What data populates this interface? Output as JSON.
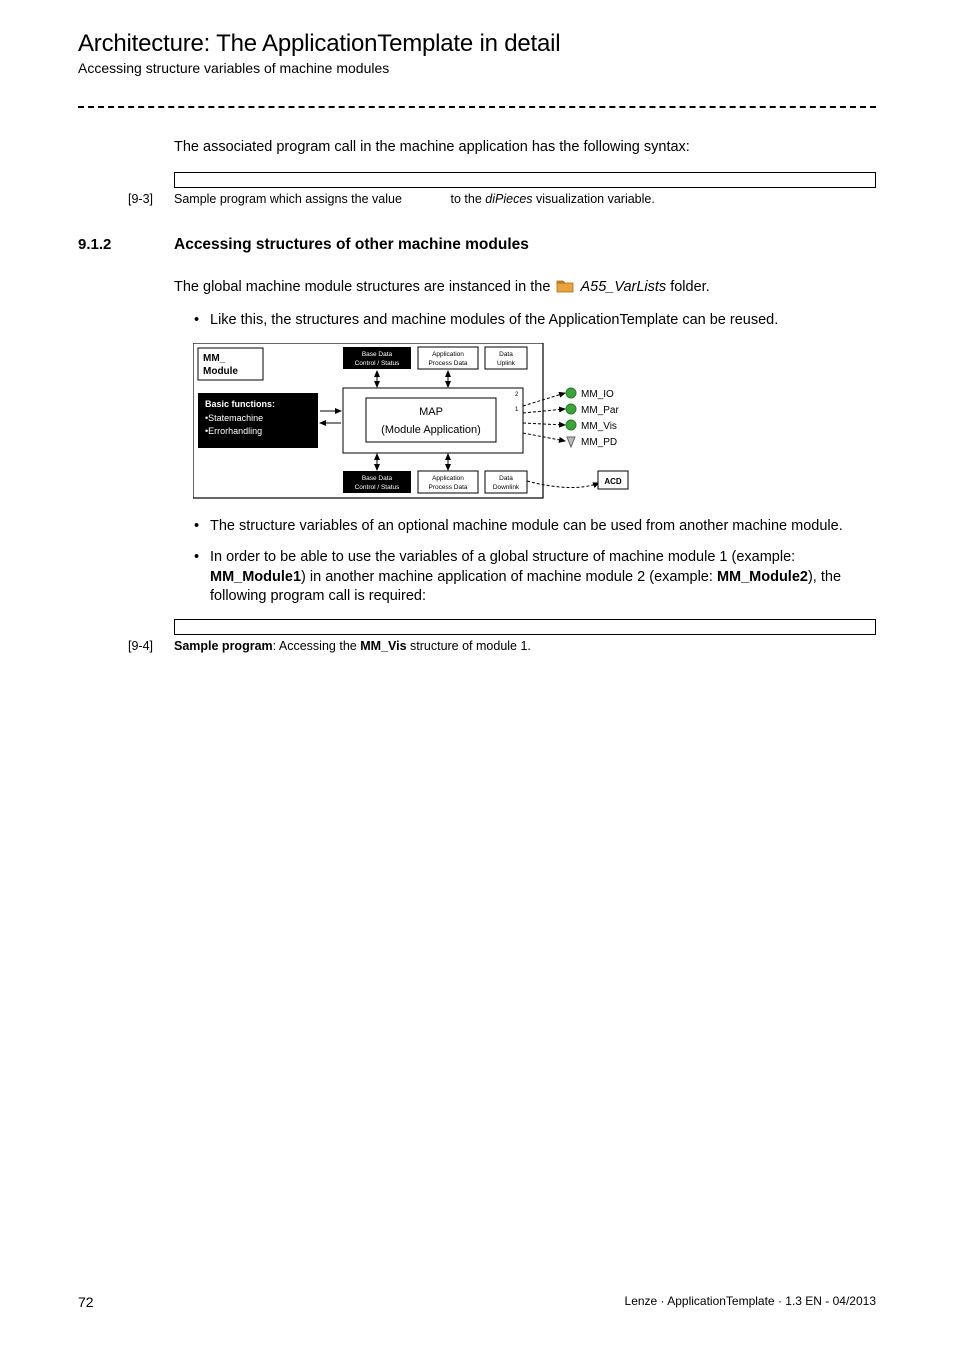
{
  "header": {
    "title": "Architecture: The ApplicationTemplate in detail",
    "subtitle": "Accessing structure variables of machine modules"
  },
  "intro_line": "The associated program call in the machine application has the following syntax:",
  "caption1": {
    "label": "[9-3]",
    "pre": "Sample program which assigns the value ",
    "gap": "            ",
    "mid": " to the ",
    "var": "diPieces",
    "post": " visualization variable."
  },
  "section": {
    "num": "9.1.2",
    "title": "Accessing structures of other machine modules"
  },
  "para1_pre": "The global machine module structures are instanced in the ",
  "para1_folder": "A55_VarLists",
  "para1_post": " folder.",
  "bullet1": "Like this, the structures and machine modules of the ApplicationTemplate can be reused.",
  "bullet2": "The structure variables of an optional machine module can be used from another machine module.",
  "bullet3_pre": "In order to be able to use the variables of a global structure of machine module 1 (example: ",
  "bullet3_b1": "MM_Module1",
  "bullet3_mid": ") in another machine application of machine module 2 (example: ",
  "bullet3_b2": "MM_Module2",
  "bullet3_post": "), the following program call is required:",
  "caption2": {
    "label": "[9-4]",
    "b1": "Sample program",
    "mid": ": Accessing the ",
    "b2": "MM_Vis",
    "post": " structure of module 1."
  },
  "diagram": {
    "mm_label1": "MM_",
    "mm_label2": "Module",
    "basic_title": "Basic functions:",
    "basic_l1": "•Statemachine",
    "basic_l2": "•Errorhandling",
    "top_box1a": "Base Data",
    "top_box1b": "Control / Status",
    "top_box2a": "Application",
    "top_box2b": "Process Data",
    "top_box3a": "Data",
    "top_box3b": "Uplink",
    "map1": "MAP",
    "map2": "(Module Application)",
    "bot_box1a": "Base Data",
    "bot_box1b": "Control / Status",
    "bot_box2a": "Application",
    "bot_box2b": "Process Data",
    "bot_box3a": "Data",
    "bot_box3b": "Downlink",
    "side1": "MM_IO",
    "side2": "MM_Par",
    "side3": "MM_Vis",
    "side4": "MM_PD",
    "acd": "ACD"
  },
  "footer": {
    "page": "72",
    "text": "Lenze · ApplicationTemplate · 1.3 EN - 04/2013"
  }
}
